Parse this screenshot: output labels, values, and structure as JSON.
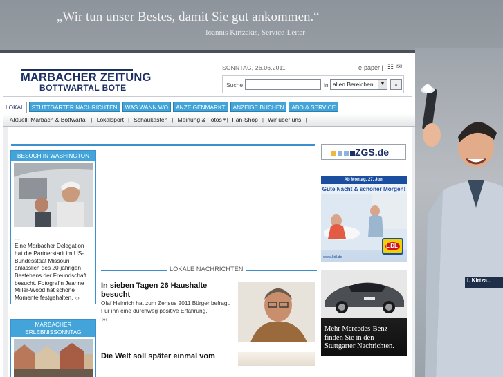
{
  "banner": {
    "quote": "„Wir tun unser Bestes, damit Sie gut ankommen.“",
    "author": "Ioannis Kirtzakis, Service-Leiter",
    "badge": "I. Kirtza..."
  },
  "header": {
    "logo_main": "MARBACHER ZEITUNG",
    "logo_sub": "BOTTWARTAL BOTE",
    "date": "SONNTAG, 26.06.2011",
    "epaper": "e-paper |",
    "sitemap_icon": "sitemap-icon",
    "mail_icon": "mail-icon"
  },
  "search": {
    "label": "Suche",
    "value": "",
    "in_label": "in",
    "scope": "allen Bereichen",
    "button_icon": "magnifier-icon"
  },
  "tabs": [
    {
      "label": "Lokal",
      "active": true
    },
    {
      "label": "Stuttgarter Nachrichten",
      "active": false
    },
    {
      "label": "Was wann wo",
      "active": false
    },
    {
      "label": "Anzeigenmarkt",
      "active": false
    },
    {
      "label": "Anzeige buchen",
      "active": false
    },
    {
      "label": "Abo & Service",
      "active": false
    }
  ],
  "subnav": [
    "Aktuell: Marbach & Bottwartal",
    "Lokalsport",
    "Schaukasten",
    "Meinung & Fotos",
    "Fan-Shop",
    "Wir über uns"
  ],
  "subnav_separator": "|",
  "subnav_dropdown_marker": "▾",
  "left_boxes": [
    {
      "title": "Besuch in Washington",
      "text": "Eine Marbacher Delegation hat die Partnerstadt im US-Bundesstaat Missouri anlässlich des 20-jährigen Bestehens der Freundschaft besucht. Fotografin Jeanne Miller-Wood hat schöne Momente festgehalten.",
      "prefix": "---"
    },
    {
      "title": "Marbacher Erlebnissonntag"
    }
  ],
  "more_marker": "›››",
  "news": {
    "section_label": "Lokale Nachrichten",
    "articles": [
      {
        "title": "In sieben Tagen 26 Haushalte besucht",
        "text": "Olaf Heinrich hat zum Zensus 2011 Bürger befragt. Für ihn eine durchweg positive Erfahrung."
      },
      {
        "title": "Die Welt soll später einmal vom"
      }
    ]
  },
  "ads": {
    "zgs": "ZGS.de",
    "zgs_colors": [
      "#f4b63f",
      "#8db3e2",
      "#1b2f63"
    ],
    "lidl_top": "Ab Montag, 27. Juni",
    "lidl_head": "Gute Nacht & schöner Morgen!",
    "lidl_logo": "LiDL",
    "lidl_url": "www.lidl.de",
    "mercedes_text": "Mehr Mercedes-Benz finden Sie in den Stuttgarter Nachrichten."
  },
  "colors": {
    "accent_blue": "#42a4d9",
    "brand_navy": "#1b2f63",
    "rule_blue": "#3d8fcd"
  }
}
